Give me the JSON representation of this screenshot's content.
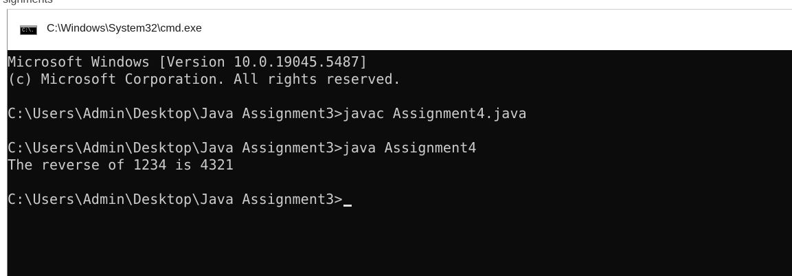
{
  "background": {
    "partial_text": "signments"
  },
  "window": {
    "title": "C:\\Windows\\System32\\cmd.exe",
    "icon": "cmd-icon",
    "icon_glyph": "C:\\."
  },
  "console": {
    "lines": [
      "Microsoft Windows [Version 10.0.19045.5487]",
      "(c) Microsoft Corporation. All rights reserved.",
      "",
      "C:\\Users\\Admin\\Desktop\\Java Assignment3>javac Assignment4.java",
      "",
      "C:\\Users\\Admin\\Desktop\\Java Assignment3>java Assignment4",
      "The reverse of 1234 is 4321",
      "",
      "C:\\Users\\Admin\\Desktop\\Java Assignment3>"
    ]
  },
  "colors": {
    "console_bg": "#0c0c0c",
    "console_fg": "#cccccc",
    "titlebar_bg": "#ffffff"
  }
}
